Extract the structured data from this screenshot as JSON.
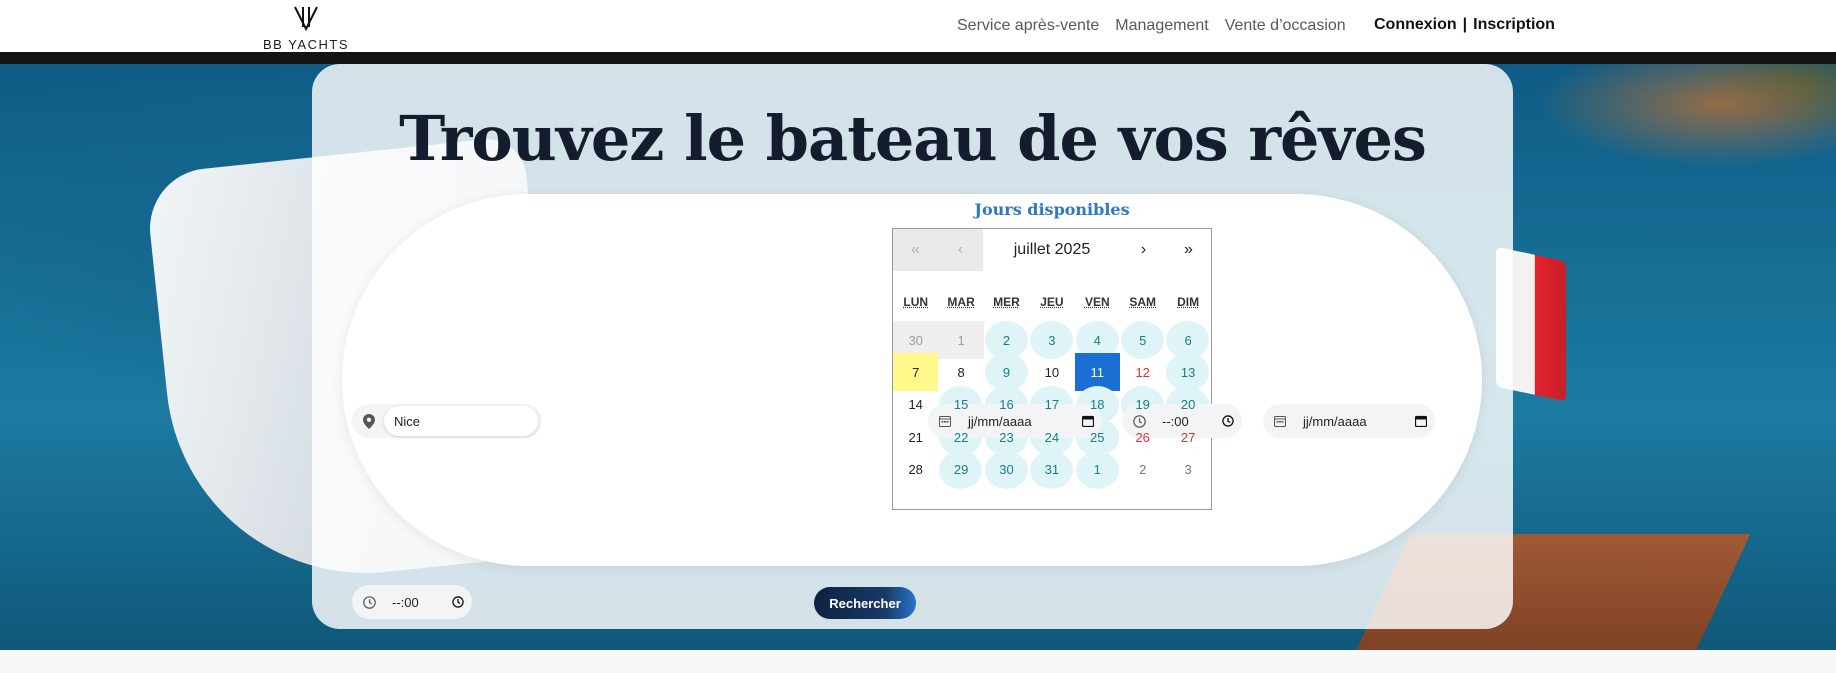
{
  "header": {
    "logo_text": "BB YACHTS",
    "nav": [
      "Service après-vente",
      "Management",
      "Vente d’occasion"
    ],
    "login": "Connexion",
    "separator": "|",
    "signup": "Inscription"
  },
  "hero": {
    "title": "Trouvez le bateau de vos rêves"
  },
  "search": {
    "location_value": "Nice",
    "date_start_placeholder": "jj/mm/aaaa",
    "time_start_placeholder": "--:00",
    "date_end_placeholder": "jj/mm/aaaa",
    "time_end_placeholder": "--:00",
    "button": "Rechercher"
  },
  "calendar": {
    "title": "Jours disponibles",
    "month_label": "juillet 2025",
    "prev_year": "«",
    "prev_month": "‹",
    "next_month": "›",
    "next_year": "»",
    "weekdays": [
      "LUN",
      "MAR",
      "MER",
      "JEU",
      "VEN",
      "SAM",
      "DIM"
    ],
    "weeks": [
      [
        {
          "d": "30",
          "s": "disabled"
        },
        {
          "d": "1",
          "s": "disabled"
        },
        {
          "d": "2",
          "s": "avail"
        },
        {
          "d": "3",
          "s": "avail"
        },
        {
          "d": "4",
          "s": "avail"
        },
        {
          "d": "5",
          "s": "avail"
        },
        {
          "d": "6",
          "s": "avail"
        }
      ],
      [
        {
          "d": "7",
          "s": "today"
        },
        {
          "d": "8",
          "s": ""
        },
        {
          "d": "9",
          "s": "avail"
        },
        {
          "d": "10",
          "s": ""
        },
        {
          "d": "11",
          "s": "selected"
        },
        {
          "d": "12",
          "s": "weekend"
        },
        {
          "d": "13",
          "s": "avail"
        }
      ],
      [
        {
          "d": "14",
          "s": ""
        },
        {
          "d": "15",
          "s": "avail"
        },
        {
          "d": "16",
          "s": "avail"
        },
        {
          "d": "17",
          "s": "avail"
        },
        {
          "d": "18",
          "s": "avail"
        },
        {
          "d": "19",
          "s": "avail"
        },
        {
          "d": "20",
          "s": "avail"
        }
      ],
      [
        {
          "d": "21",
          "s": ""
        },
        {
          "d": "22",
          "s": "avail"
        },
        {
          "d": "23",
          "s": "avail"
        },
        {
          "d": "24",
          "s": "avail"
        },
        {
          "d": "25",
          "s": "avail"
        },
        {
          "d": "26",
          "s": "weekend"
        },
        {
          "d": "27",
          "s": "weekend"
        }
      ],
      [
        {
          "d": "28",
          "s": ""
        },
        {
          "d": "29",
          "s": "avail"
        },
        {
          "d": "30",
          "s": "avail"
        },
        {
          "d": "31",
          "s": "avail"
        },
        {
          "d": "1",
          "s": "avail"
        },
        {
          "d": "2",
          "s": "neighbor"
        },
        {
          "d": "3",
          "s": "neighbor"
        }
      ]
    ]
  },
  "colors": {
    "accent": "#2d78c3",
    "selected_day": "#1a6fd4",
    "available_day": "#def4f6",
    "today": "#fff98c",
    "weekend": "#dd3333",
    "title": "#141c2e"
  },
  "icons": {
    "location": "map-pin-icon",
    "calendar": "calendar-icon",
    "clock": "clock-icon"
  }
}
